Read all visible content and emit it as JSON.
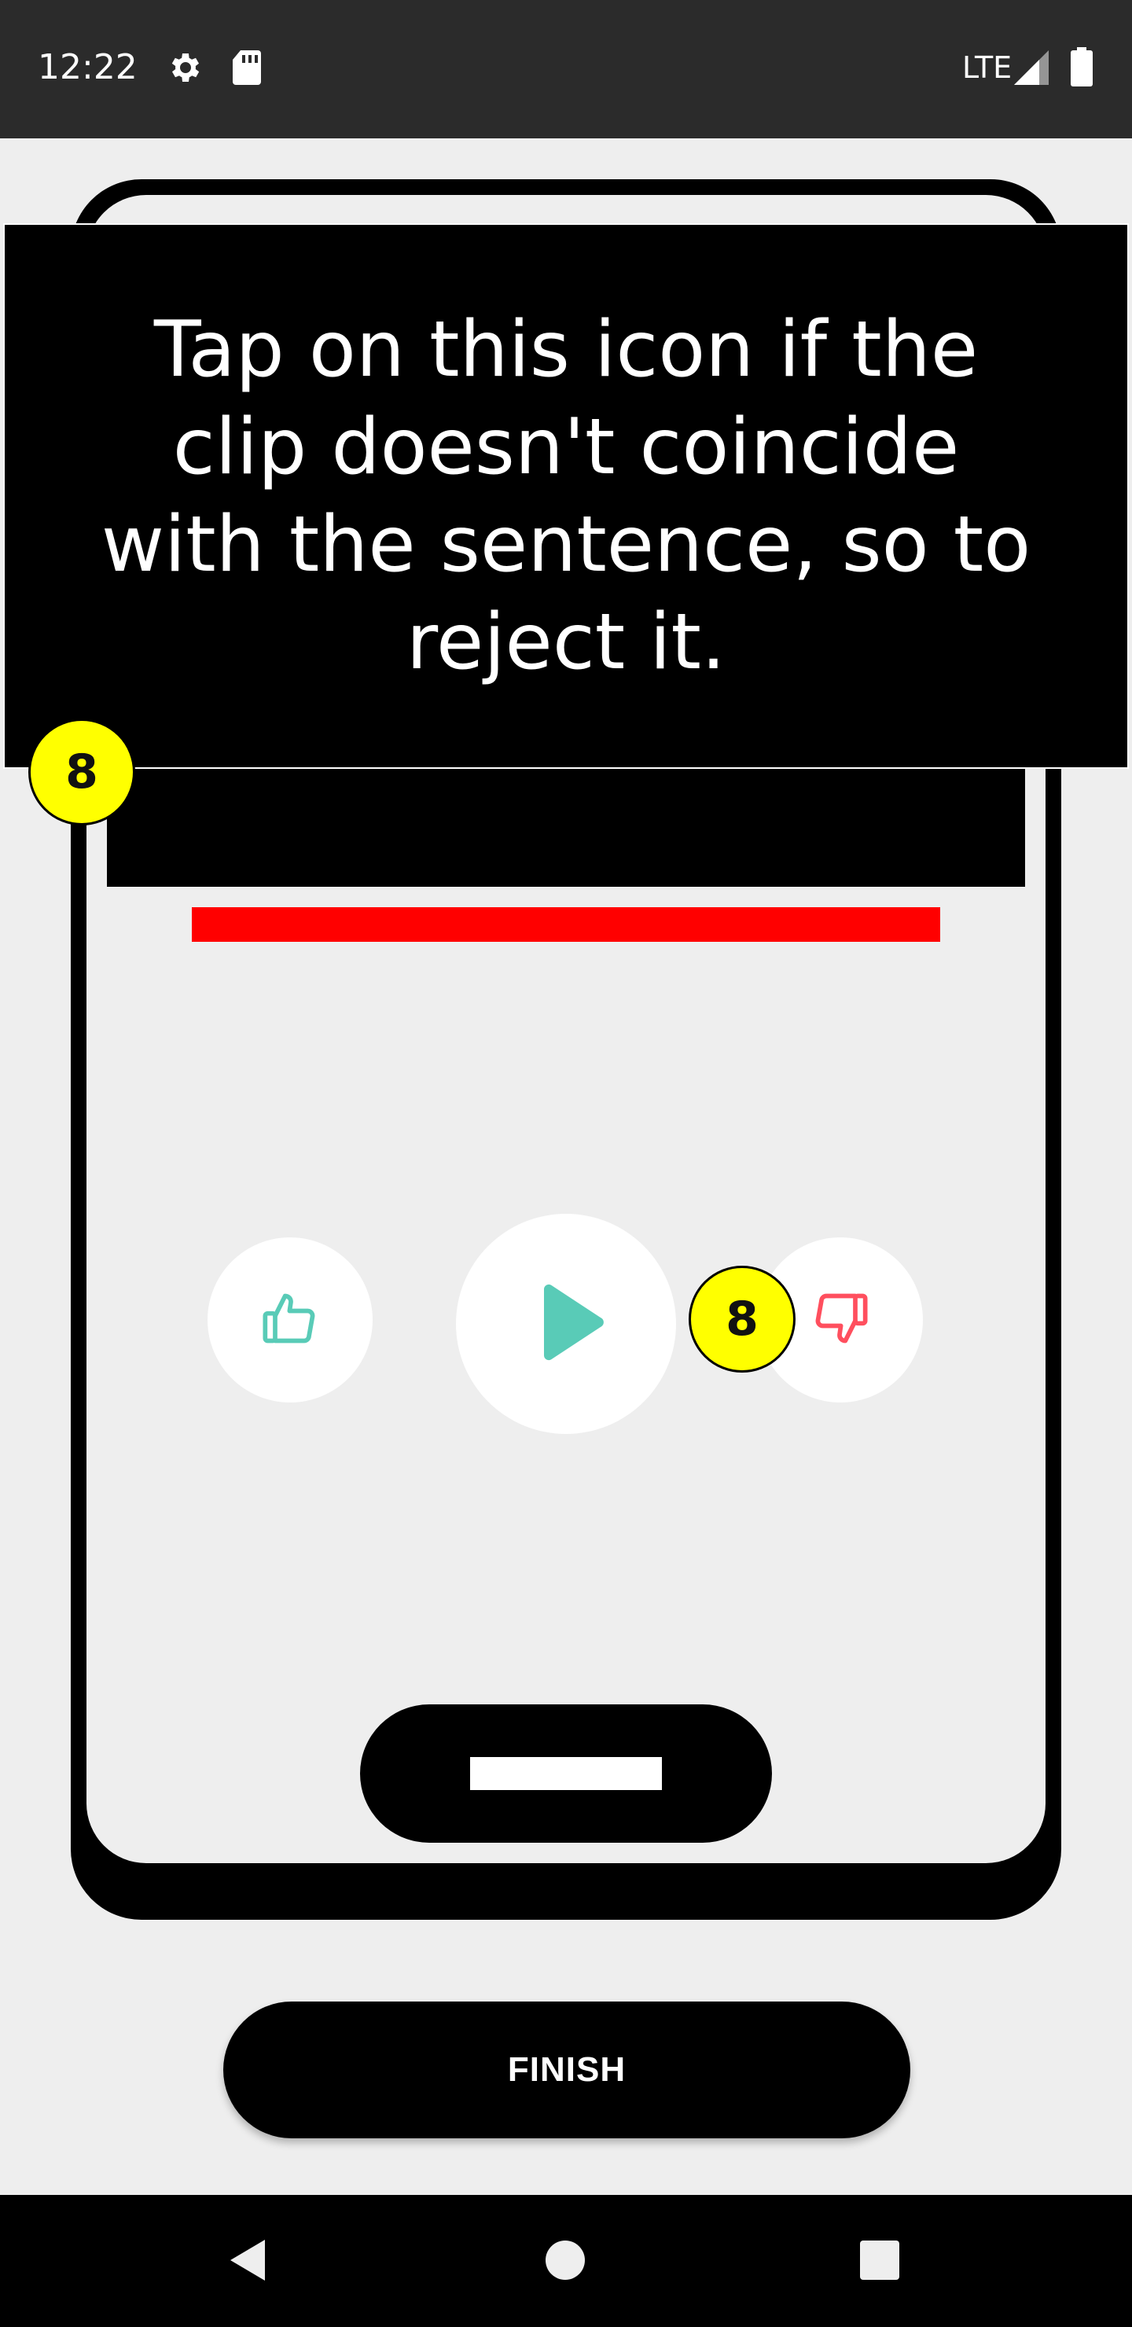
{
  "status_bar": {
    "time": "12:22",
    "network": "LTE",
    "icons": [
      "settings-icon",
      "sd-card-icon",
      "signal-icon",
      "battery-icon"
    ]
  },
  "tutorial": {
    "tooltip_text": "Tap on this icon if the clip doesn't coincide with the sentence, so to reject it.",
    "badge_top": "8",
    "badge_reject": "8"
  },
  "controls": {
    "like_icon": "thumbs-up-icon",
    "play_icon": "play-icon",
    "dislike_icon": "thumbs-down-icon"
  },
  "finish": {
    "label": "FINISH"
  },
  "colors": {
    "accent_green": "#59cbb7",
    "reject_red": "#ff4f5e",
    "badge_yellow": "#ffff00",
    "progress_red": "#ff0000"
  },
  "nav_bar": {
    "icons": [
      "back-icon",
      "home-icon",
      "recents-icon"
    ]
  }
}
